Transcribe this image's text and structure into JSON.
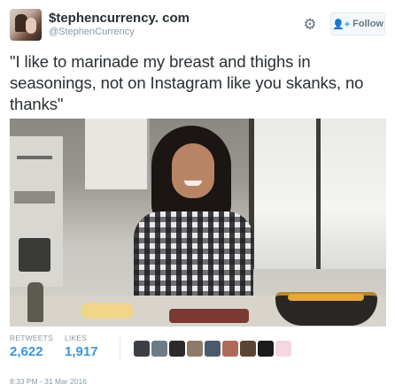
{
  "user": {
    "display_name": "$tephencurrency. com",
    "handle": "@StephenCurrency"
  },
  "actions": {
    "follow_label": "Follow"
  },
  "tweet": {
    "text": "\"I like to marinade my breast and thighs in seasonings, not on Instagram like you skanks, no thanks\""
  },
  "stats": {
    "retweets_label": "RETWEETS",
    "retweets_value": "2,622",
    "likes_label": "LIKES",
    "likes_value": "1,917"
  },
  "likers": [
    {
      "name": "liker-avatar",
      "color": "#3b3f45"
    },
    {
      "name": "liker-avatar",
      "color": "#6d7c86"
    },
    {
      "name": "liker-avatar",
      "color": "#2d2a2a"
    },
    {
      "name": "liker-avatar",
      "color": "#8c7b6a"
    },
    {
      "name": "liker-avatar",
      "color": "#4a5a6a"
    },
    {
      "name": "liker-avatar",
      "color": "#b06a5a"
    },
    {
      "name": "liker-avatar",
      "color": "#5a4433"
    },
    {
      "name": "liker-avatar",
      "color": "#1d1b1a"
    },
    {
      "name": "liker-avatar",
      "color": "#f6d6df"
    }
  ],
  "timestamp": "8:33 PM - 31 Mar 2016",
  "icons": {
    "settings": "gear-icon",
    "follow": "person-plus-icon"
  },
  "colors": {
    "link_blue": "#3b94d9",
    "muted": "#8899a6"
  }
}
